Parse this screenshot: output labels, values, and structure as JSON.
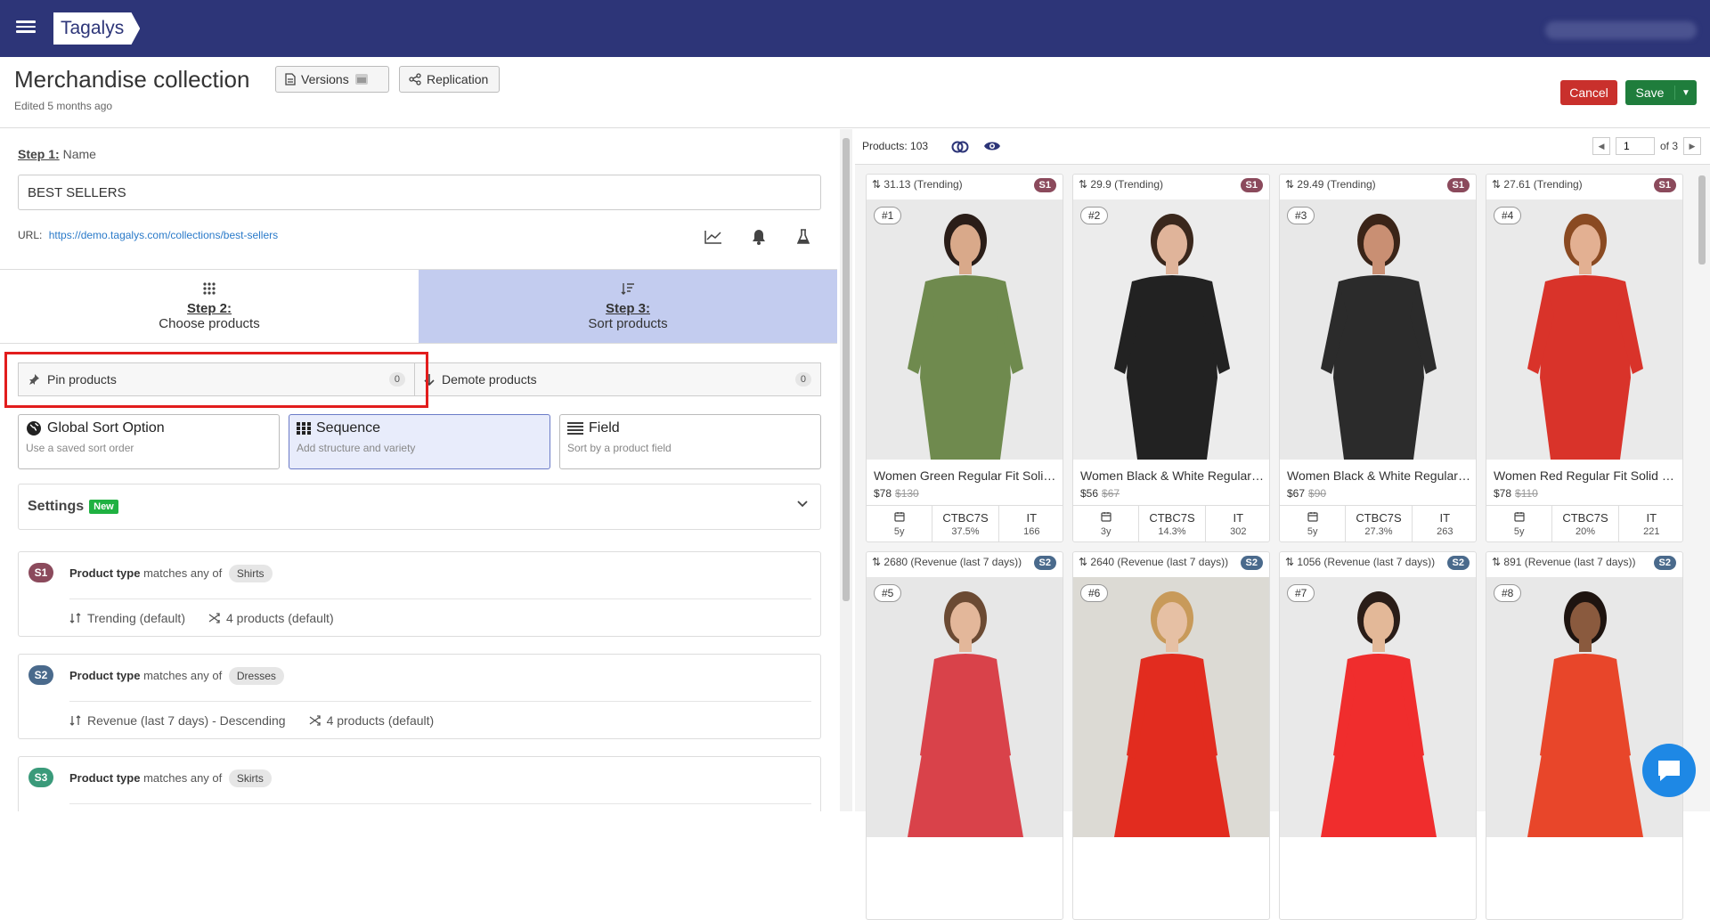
{
  "app": {
    "logo": "Tagalys"
  },
  "header": {
    "title": "Merchandise collection",
    "edited": "Edited 5 months ago",
    "versions_label": "Versions",
    "replication_label": "Replication",
    "cancel_label": "Cancel",
    "save_label": "Save"
  },
  "step1": {
    "label": "Step 1:",
    "text": "Name",
    "name_value": "BEST SELLERS",
    "url_label": "URL:",
    "url": "https://demo.tagalys.com/collections/best-sellers"
  },
  "tabs": [
    {
      "step": "Step 2:",
      "label": "Choose products"
    },
    {
      "step": "Step 3:",
      "label": "Sort products"
    }
  ],
  "pin": {
    "label": "Pin products",
    "count": "0"
  },
  "demote": {
    "label": "Demote products",
    "count": "0"
  },
  "sort_options": [
    {
      "title": "Global Sort Option",
      "desc": "Use a saved sort order"
    },
    {
      "title": "Sequence",
      "desc": "Add structure and variety"
    },
    {
      "title": "Field",
      "desc": "Sort by a product field"
    }
  ],
  "settings": {
    "label": "Settings",
    "badge": "New"
  },
  "segments": [
    {
      "badge": "S1",
      "color": "#8b4a5c",
      "field": "Product type",
      "op": "matches any of",
      "value": "Shirts",
      "sort": "Trending (default)",
      "count": "4 products (default)"
    },
    {
      "badge": "S2",
      "color": "#4a6a8c",
      "field": "Product type",
      "op": "matches any of",
      "value": "Dresses",
      "sort": "Revenue (last 7 days) - Descending",
      "count": "4 products (default)"
    },
    {
      "badge": "S3",
      "color": "#3a9a7a",
      "field": "Product type",
      "op": "matches any of",
      "value": "Skirts",
      "sort": "",
      "count": ""
    }
  ],
  "results": {
    "products_label": "Products:",
    "products_count": "103",
    "page": "1",
    "of_pages": "of 3"
  },
  "cards": [
    {
      "score": "31.13 (Trending)",
      "seg": "S1",
      "segcolor": "#8b4a5c",
      "rank": "#1",
      "name": "Women Green Regular Fit Solid Casual Shirt",
      "price": "$78",
      "old": "$130",
      "age": "5y",
      "ctb": "CTBC7S",
      "ctbv": "37.5%",
      "it": "IT",
      "itv": "166",
      "bg": "#e9e9e9",
      "cloth": "#6f8a4e",
      "skin": "#d9a98a",
      "hair": "#2a1d18"
    },
    {
      "score": "29.9 (Trending)",
      "seg": "S1",
      "segcolor": "#8b4a5c",
      "rank": "#2",
      "name": "Women Black & White Regular Fit Checked Casual Shirt",
      "price": "$56",
      "old": "$67",
      "age": "3y",
      "ctb": "CTBC7S",
      "ctbv": "14.3%",
      "it": "IT",
      "itv": "302",
      "bg": "#ececec",
      "cloth": "#222222",
      "skin": "#e0b49a",
      "hair": "#3a271c"
    },
    {
      "score": "29.49 (Trending)",
      "seg": "S1",
      "segcolor": "#8b4a5c",
      "rank": "#3",
      "name": "Women Black & White Regular Fit Printed Casual Shirt",
      "price": "$67",
      "old": "$90",
      "age": "5y",
      "ctb": "CTBC7S",
      "ctbv": "27.3%",
      "it": "IT",
      "itv": "263",
      "bg": "#e8e8e8",
      "cloth": "#2b2b2b",
      "skin": "#c98f73",
      "hair": "#3a2418"
    },
    {
      "score": "27.61 (Trending)",
      "seg": "S1",
      "segcolor": "#8b4a5c",
      "rank": "#4",
      "name": "Women Red Regular Fit Solid Casual Shirt",
      "price": "$78",
      "old": "$110",
      "age": "5y",
      "ctb": "CTBC7S",
      "ctbv": "20%",
      "it": "IT",
      "itv": "221",
      "bg": "#eaeaea",
      "cloth": "#d9332a",
      "skin": "#e3b092",
      "hair": "#8a4a22"
    },
    {
      "score": "2680 (Revenue (last 7 days))",
      "seg": "S2",
      "segcolor": "#4a6a8c",
      "rank": "#5",
      "bg": "#e7e7e7",
      "cloth": "#d9424a",
      "skin": "#e3b79a",
      "hair": "#6b4a33"
    },
    {
      "score": "2640 (Revenue (last 7 days))",
      "seg": "S2",
      "segcolor": "#4a6a8c",
      "rank": "#6",
      "bg": "#dcdad4",
      "cloth": "#e22c1f",
      "skin": "#e6c0a4",
      "hair": "#c89a5a"
    },
    {
      "score": "1056 (Revenue (last 7 days))",
      "seg": "S2",
      "segcolor": "#4a6a8c",
      "rank": "#7",
      "bg": "#e9e9e9",
      "cloth": "#f02d2d",
      "skin": "#e3b898",
      "hair": "#2a1d18"
    },
    {
      "score": "891 (Revenue (last 7 days))",
      "seg": "S2",
      "segcolor": "#4a6a8c",
      "rank": "#8",
      "bg": "#e8e8e8",
      "cloth": "#e8462a",
      "skin": "#8a5a3e",
      "hair": "#1e1410"
    }
  ]
}
